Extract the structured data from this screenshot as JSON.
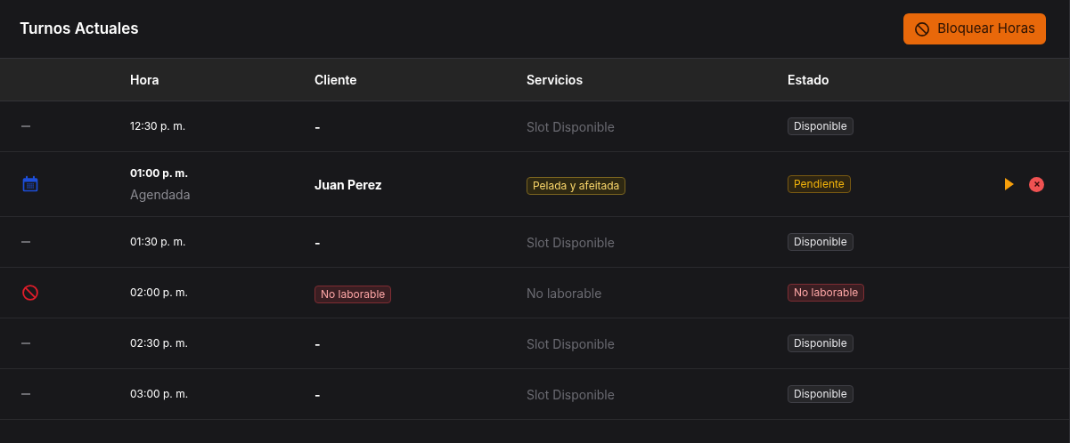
{
  "title": "Turnos Actuales",
  "block_button": {
    "label": "Bloquear Horas"
  },
  "columns": [
    "Hora",
    "Cliente",
    "Servicios",
    "Estado"
  ],
  "rows": [
    {
      "kind": "free",
      "time": "12:30 p. m.",
      "client": "-",
      "service": "Slot Disponible",
      "status": "Disponible"
    },
    {
      "kind": "booked",
      "time": "01:00 p. m.",
      "subtitle": "Agendada",
      "client": "Juan Perez",
      "service": "Pelada y afeitada",
      "status": "Pendiente"
    },
    {
      "kind": "free",
      "time": "01:30 p. m.",
      "client": "-",
      "service": "Slot Disponible",
      "status": "Disponible"
    },
    {
      "kind": "blocked",
      "time": "02:00 p. m.",
      "client": "No laborable",
      "service": "No laborable",
      "status": "No laborable"
    },
    {
      "kind": "free",
      "time": "02:30 p. m.",
      "client": "-",
      "service": "Slot Disponible",
      "status": "Disponible"
    },
    {
      "kind": "free",
      "time": "03:00 p. m.",
      "client": "-",
      "service": "Slot Disponible",
      "status": "Disponible"
    }
  ]
}
